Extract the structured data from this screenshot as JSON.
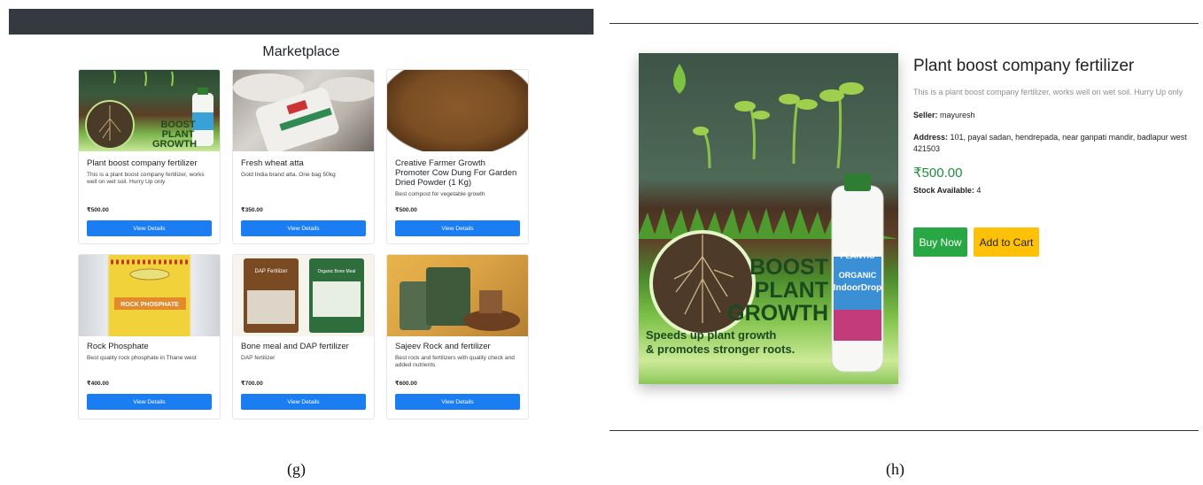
{
  "marketplace": {
    "title": "Marketplace",
    "view_details_label": "View Details",
    "products": [
      {
        "name": "Plant boost company fertilizer",
        "description": "This is a plant boost company fertilizer, works well on wet soil. Hurry Up only",
        "price": "₹500.00",
        "image_text": [
          "BOOST",
          "PLANT",
          "GROWTH"
        ]
      },
      {
        "name": "Fresh wheat atta",
        "description": "Gold India brand atta. One bag 50kg",
        "price": "₹350.00"
      },
      {
        "name": "Creative Farmer Growth Promoter Cow Dung For Garden Dried Powder (1 Kg)",
        "description": "Best compost for vegetable growth",
        "price": "₹500.00"
      },
      {
        "name": "Rock Phosphate",
        "description": "Best quality rock phosphate in Thane west",
        "price": "₹400.00",
        "image_text": [
          "ROCK PHOSPHATE"
        ]
      },
      {
        "name": "Bone meal and DAP fertilizer",
        "description": "DAP fertilizer",
        "price": "₹700.00",
        "image_text": [
          "DAP Fertilizer",
          "Organic Bone Meal"
        ]
      },
      {
        "name": "Sajeev Rock and fertilizer",
        "description": "Best rock and fertilizers with quality check and added nutrients",
        "price": "₹600.00"
      }
    ]
  },
  "detail": {
    "title": "Plant boost company fertilizer",
    "description": "This is a plant boost company fertilizer, works well on wet soil. Hurry Up only",
    "seller_label": "Seller:",
    "seller": "mayuresh",
    "address_label": "Address:",
    "address": "101, payal sadan, hendrepada, near ganpati mandir, badlapur west 421503",
    "price": "₹500.00",
    "stock_label": "Stock Available:",
    "stock": "4",
    "buy_now_label": "Buy Now",
    "add_to_cart_label": "Add to Cart",
    "image_text": {
      "headline": [
        "BOOST",
        "PLANT",
        "GROWTH"
      ],
      "tagline": [
        "Speeds up plant growth",
        "& promotes stronger roots."
      ],
      "bottle_brand": "PLANTIC",
      "bottle_label": [
        "ORGANIC",
        "IndoorDrop"
      ]
    }
  },
  "captions": {
    "left": "(g)",
    "right": "(h)"
  },
  "colors": {
    "primary_button": "#1a7ef2",
    "buy_button": "#28a745",
    "cart_button": "#ffc107",
    "navbar": "#343a40",
    "price_green": "#1e8e3e"
  }
}
